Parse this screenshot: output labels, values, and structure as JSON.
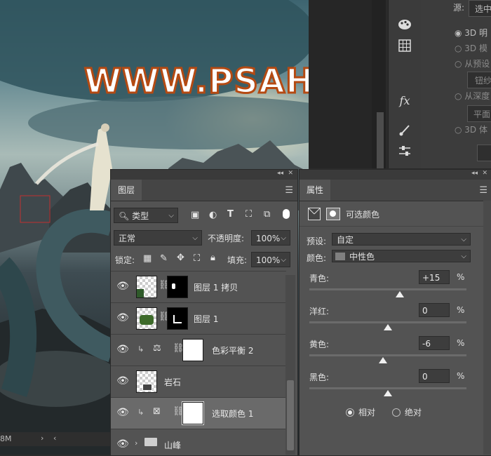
{
  "watermark": "WWW.PSAHZ.COM",
  "status_bar": {
    "left": "8M",
    "arrow": "›",
    "arrow2": "‹"
  },
  "top_panel": {
    "source_label": "源:",
    "source_value": "选中",
    "items": [
      "3D 明",
      "3D 模",
      "从预设",
      "钮纱",
      "从深度",
      "平面",
      "3D 体"
    ]
  },
  "toolstrip": {
    "icons": [
      "palette-icon",
      "grid-icon",
      "fx-icon",
      "brushes-icon",
      "sliders-icon"
    ],
    "fx_label": "fx"
  },
  "layers_panel": {
    "tab": "图层",
    "filter": {
      "icon": "search-icon",
      "value": "类型"
    },
    "blend_mode": "正常",
    "opacity_label": "不透明度:",
    "opacity_value": "100%",
    "lock_label": "锁定:",
    "fill_label": "填充:",
    "fill_value": "100%",
    "layers": [
      {
        "name": "图层 1 拷贝",
        "selected": false
      },
      {
        "name": "图层 1",
        "selected": false
      },
      {
        "name": "色彩平衡 2",
        "selected": false
      },
      {
        "name": "岩石",
        "selected": false
      },
      {
        "name": "选取颜色 1",
        "selected": true
      },
      {
        "name": "山峰",
        "selected": false
      }
    ]
  },
  "properties_panel": {
    "tab": "属性",
    "adjustment_title": "可选颜色",
    "preset_label": "预设:",
    "preset_value": "自定",
    "colors_label": "颜色:",
    "colors_value": "中性色",
    "sliders": [
      {
        "label": "青色:",
        "value": "+15",
        "unit": "%",
        "level": 0.575
      },
      {
        "label": "洋红:",
        "value": "0",
        "unit": "%",
        "level": 0.5
      },
      {
        "label": "黄色:",
        "value": "-6",
        "unit": "%",
        "level": 0.47
      },
      {
        "label": "黑色:",
        "value": "0",
        "unit": "%",
        "level": 0.5
      }
    ],
    "method": {
      "relative": "相对",
      "absolute": "绝对",
      "selected": "relative"
    }
  },
  "colors": {
    "accent_watermark": "#b54a12",
    "panel_bg": "#535353",
    "selected_row": "#6a6a6a"
  }
}
